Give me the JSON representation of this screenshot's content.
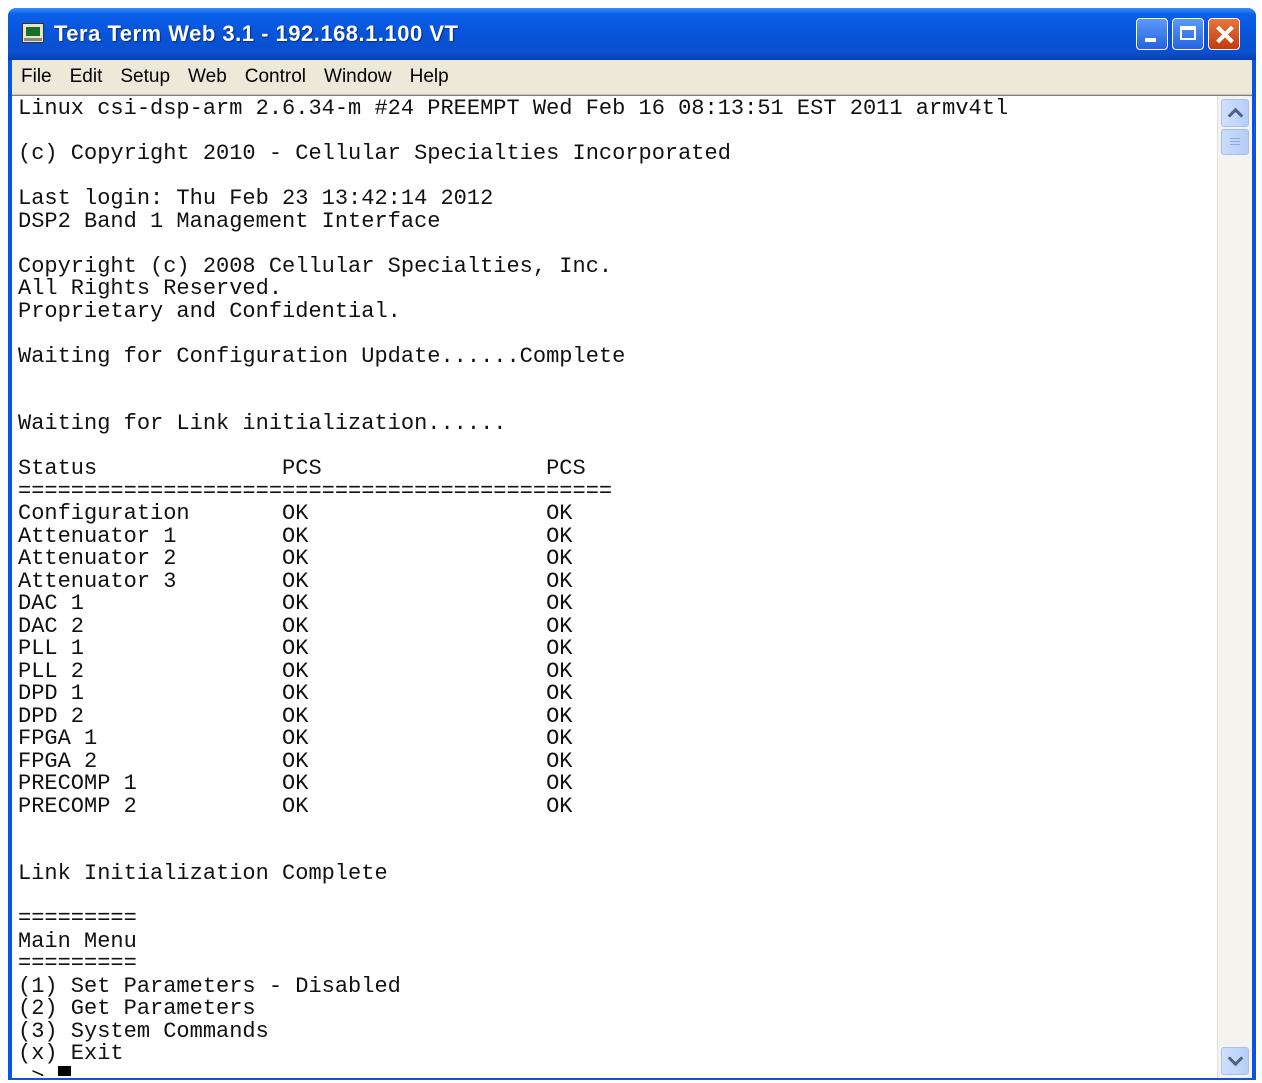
{
  "window": {
    "title": "Tera Term Web 3.1 - 192.168.1.100 VT"
  },
  "menu": [
    "File",
    "Edit",
    "Setup",
    "Web",
    "Control",
    "Window",
    "Help"
  ],
  "terminal": {
    "lines": [
      "Linux csi-dsp-arm 2.6.34-m #24 PREEMPT Wed Feb 16 08:13:51 EST 2011 armv4tl",
      "",
      "(c) Copyright 2010 - Cellular Specialties Incorporated",
      "",
      "Last login: Thu Feb 23 13:42:14 2012",
      "DSP2 Band 1 Management Interface",
      "",
      "Copyright (c) 2008 Cellular Specialties, Inc.",
      "All Rights Reserved.",
      "Proprietary and Confidential.",
      "",
      "Waiting for Configuration Update......Complete",
      "",
      "",
      "Waiting for Link initialization......",
      "",
      "Status              PCS                 PCS",
      "=============================================",
      "Configuration       OK                  OK",
      "Attenuator 1        OK                  OK",
      "Attenuator 2        OK                  OK",
      "Attenuator 3        OK                  OK",
      "DAC 1               OK                  OK",
      "DAC 2               OK                  OK",
      "PLL 1               OK                  OK",
      "PLL 2               OK                  OK",
      "DPD 1               OK                  OK",
      "DPD 2               OK                  OK",
      "FPGA 1              OK                  OK",
      "FPGA 2              OK                  OK",
      "PRECOMP 1           OK                  OK",
      "PRECOMP 2           OK                  OK",
      "",
      "",
      "Link Initialization Complete",
      "",
      "=========",
      "Main Menu",
      "=========",
      "(1) Set Parameters - Disabled",
      "(2) Get Parameters",
      "(3) System Commands",
      "(x) Exit",
      "-> "
    ]
  }
}
